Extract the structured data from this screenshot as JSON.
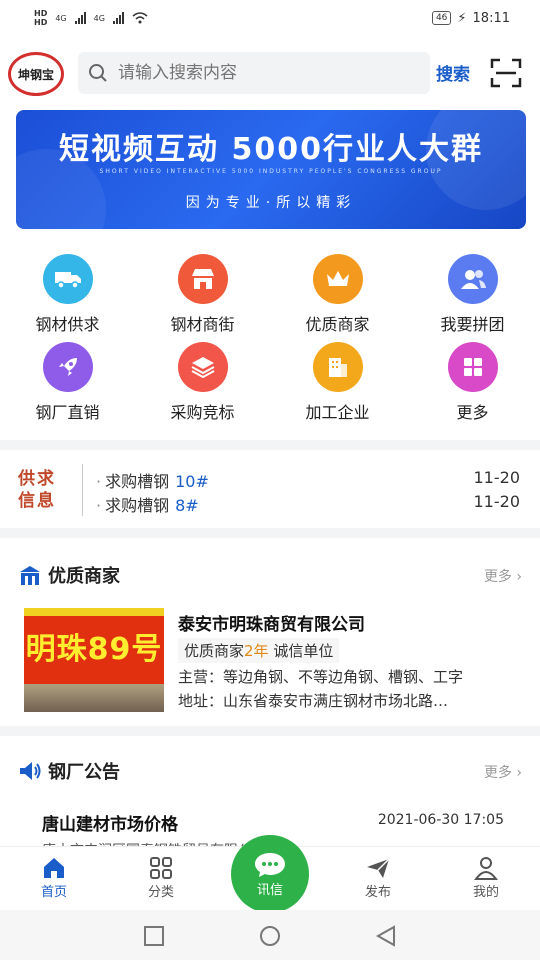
{
  "status_bar": {
    "hd1": "HD",
    "hd2": "HD",
    "net1": "4G",
    "net2": "4G",
    "battery": "46",
    "time": "18:11"
  },
  "header": {
    "logo_text": "坤钢宝",
    "search_placeholder": "请输入搜索内容",
    "search_label": "搜索"
  },
  "banner": {
    "title": "短视频互动 5000行业人大群",
    "subtitle_en": "SHORT VIDEO INTERACTIVE 5000 INDUSTRY PEOPLE'S CONGRESS GROUP",
    "slogan": "因为专业·所以精彩"
  },
  "grid": [
    {
      "label": "钢材供求",
      "icon": "truck-icon",
      "color": "#35b6e8"
    },
    {
      "label": "钢材商街",
      "icon": "store-icon",
      "color": "#f05a3a"
    },
    {
      "label": "优质商家",
      "icon": "crown-icon",
      "color": "#f39a1e"
    },
    {
      "label": "我要拼团",
      "icon": "group-icon",
      "color": "#5b7cf0"
    },
    {
      "label": "钢厂直销",
      "icon": "rocket-icon",
      "color": "#8e5ce8"
    },
    {
      "label": "采购竞标",
      "icon": "layers-icon",
      "color": "#f2554a"
    },
    {
      "label": "加工企业",
      "icon": "building-icon",
      "color": "#f3a81c"
    },
    {
      "label": "更多",
      "icon": "grid-icon",
      "color": "#d84ac8"
    }
  ],
  "supply": {
    "tag": "供求信息",
    "items": [
      {
        "text": "求购槽钢",
        "code": "10#",
        "date": "11-20"
      },
      {
        "text": "求购槽钢",
        "code": "8#",
        "date": "11-20"
      }
    ]
  },
  "merchants_section": {
    "title": "优质商家",
    "more": "更多"
  },
  "merchant": {
    "image_text": "明珠89号",
    "name": "泰安市明珠商贸有限公司",
    "badge_prefix": "优质商家",
    "badge_years": "2年",
    "badge_suffix": " 诚信单位",
    "main": "主营：等边角钢、不等边角钢、槽钢、工字",
    "address": "地址：山东省泰安市满庄钢材市场北路…"
  },
  "notice_section": {
    "title": "钢厂公告",
    "more": "更多"
  },
  "notice": {
    "title": "唐山建材市场价格",
    "date": "2021-06-30 17:05",
    "sub": "唐山市丰润区国泰钢铁贸易有限公司"
  },
  "bottom_nav": {
    "home": "首页",
    "category": "分类",
    "message": "讯信",
    "publish": "发布",
    "mine": "我的"
  },
  "colors": {
    "accent": "#1a5dc8",
    "brand_green": "#2eb148",
    "supply_tag": "#c0492b"
  }
}
